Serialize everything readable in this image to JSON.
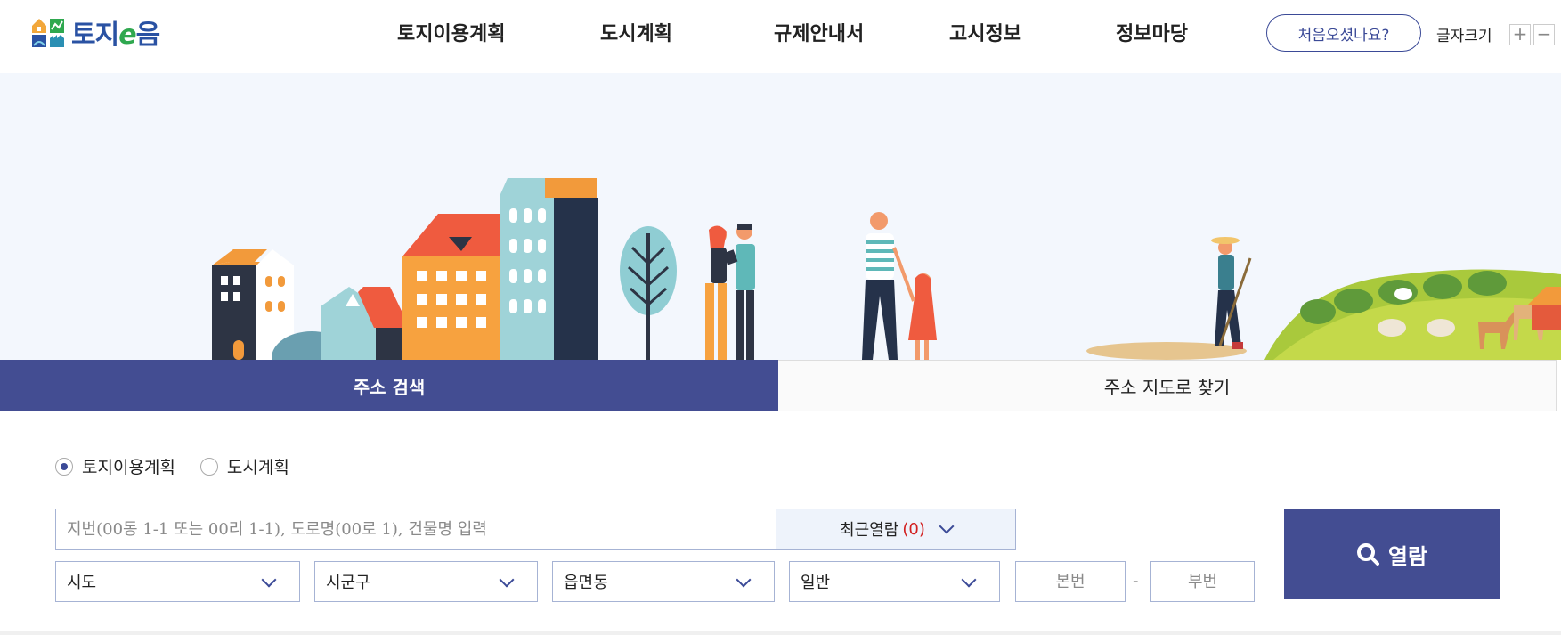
{
  "header": {
    "logo_text_1": "토지",
    "logo_text_e": "e",
    "logo_text_2": "음",
    "nav": [
      "토지이용계획",
      "도시계획",
      "규제안내서",
      "고시정보",
      "정보마당"
    ],
    "first_visit": "처음오셨나요?",
    "font_size_label": "글자크기",
    "font_plus": "+",
    "font_minus": "−"
  },
  "tabs": {
    "address_search": "주소 검색",
    "map_search": "주소 지도로 찾기"
  },
  "search": {
    "radio_land": "토지이용계획",
    "radio_city": "도시계획",
    "selected_radio": "토지이용계획",
    "placeholder": "지번(00동 1-1 또는 00리 1-1), 도로명(00로 1), 건물명 입력",
    "recent_label": "최근열람",
    "recent_count": "(0)",
    "sido": "시도",
    "sigungu": "시군구",
    "eupmyeondong": "읍면동",
    "general": "일반",
    "main_no_placeholder": "본번",
    "dash": "-",
    "sub_no_placeholder": "부번",
    "open_button": "열람"
  },
  "colors": {
    "primary": "#434d92",
    "accent_red": "#d21f1f",
    "hero_bg": "#f3f7fd"
  },
  "icons": {
    "logo": "house-factory-logo-icon",
    "search": "magnifier-icon",
    "dropdown": "chevron-down-icon"
  }
}
